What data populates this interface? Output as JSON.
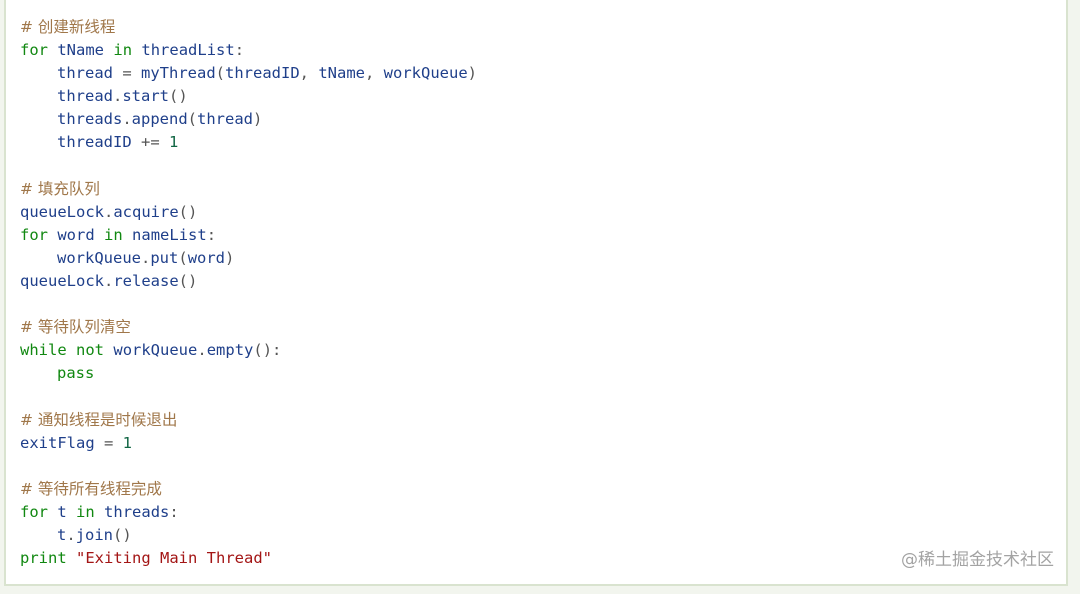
{
  "code_lines": [
    {
      "indent": false,
      "tokens": [
        {
          "t": "cm",
          "v": "# 创建新线程"
        }
      ]
    },
    {
      "indent": false,
      "tokens": [
        {
          "t": "kw",
          "v": "for"
        },
        {
          "t": "op",
          "v": " "
        },
        {
          "t": "id",
          "v": "tName"
        },
        {
          "t": "op",
          "v": " "
        },
        {
          "t": "kw",
          "v": "in"
        },
        {
          "t": "op",
          "v": " "
        },
        {
          "t": "id",
          "v": "threadList"
        },
        {
          "t": "op",
          "v": ":"
        }
      ]
    },
    {
      "indent": true,
      "tokens": [
        {
          "t": "id",
          "v": "thread"
        },
        {
          "t": "op",
          "v": " = "
        },
        {
          "t": "id",
          "v": "myThread"
        },
        {
          "t": "op",
          "v": "("
        },
        {
          "t": "id",
          "v": "threadID"
        },
        {
          "t": "op",
          "v": ", "
        },
        {
          "t": "id",
          "v": "tName"
        },
        {
          "t": "op",
          "v": ", "
        },
        {
          "t": "id",
          "v": "workQueue"
        },
        {
          "t": "op",
          "v": ")"
        }
      ]
    },
    {
      "indent": true,
      "tokens": [
        {
          "t": "id",
          "v": "thread"
        },
        {
          "t": "op",
          "v": "."
        },
        {
          "t": "id",
          "v": "start"
        },
        {
          "t": "op",
          "v": "()"
        }
      ]
    },
    {
      "indent": true,
      "tokens": [
        {
          "t": "id",
          "v": "threads"
        },
        {
          "t": "op",
          "v": "."
        },
        {
          "t": "id",
          "v": "append"
        },
        {
          "t": "op",
          "v": "("
        },
        {
          "t": "id",
          "v": "thread"
        },
        {
          "t": "op",
          "v": ")"
        }
      ]
    },
    {
      "indent": true,
      "tokens": [
        {
          "t": "id",
          "v": "threadID"
        },
        {
          "t": "op",
          "v": " += "
        },
        {
          "t": "num",
          "v": "1"
        }
      ]
    },
    {
      "indent": false,
      "tokens": []
    },
    {
      "indent": false,
      "tokens": [
        {
          "t": "cm",
          "v": "# 填充队列"
        }
      ]
    },
    {
      "indent": false,
      "tokens": [
        {
          "t": "id",
          "v": "queueLock"
        },
        {
          "t": "op",
          "v": "."
        },
        {
          "t": "id",
          "v": "acquire"
        },
        {
          "t": "op",
          "v": "()"
        }
      ]
    },
    {
      "indent": false,
      "tokens": [
        {
          "t": "kw",
          "v": "for"
        },
        {
          "t": "op",
          "v": " "
        },
        {
          "t": "id",
          "v": "word"
        },
        {
          "t": "op",
          "v": " "
        },
        {
          "t": "kw",
          "v": "in"
        },
        {
          "t": "op",
          "v": " "
        },
        {
          "t": "id",
          "v": "nameList"
        },
        {
          "t": "op",
          "v": ":"
        }
      ]
    },
    {
      "indent": true,
      "tokens": [
        {
          "t": "id",
          "v": "workQueue"
        },
        {
          "t": "op",
          "v": "."
        },
        {
          "t": "id",
          "v": "put"
        },
        {
          "t": "op",
          "v": "("
        },
        {
          "t": "id",
          "v": "word"
        },
        {
          "t": "op",
          "v": ")"
        }
      ]
    },
    {
      "indent": false,
      "tokens": [
        {
          "t": "id",
          "v": "queueLock"
        },
        {
          "t": "op",
          "v": "."
        },
        {
          "t": "id",
          "v": "release"
        },
        {
          "t": "op",
          "v": "()"
        }
      ]
    },
    {
      "indent": false,
      "tokens": []
    },
    {
      "indent": false,
      "tokens": [
        {
          "t": "cm",
          "v": "# 等待队列清空"
        }
      ]
    },
    {
      "indent": false,
      "tokens": [
        {
          "t": "kw",
          "v": "while"
        },
        {
          "t": "op",
          "v": " "
        },
        {
          "t": "kw",
          "v": "not"
        },
        {
          "t": "op",
          "v": " "
        },
        {
          "t": "id",
          "v": "workQueue"
        },
        {
          "t": "op",
          "v": "."
        },
        {
          "t": "id",
          "v": "empty"
        },
        {
          "t": "op",
          "v": "():"
        }
      ]
    },
    {
      "indent": true,
      "tokens": [
        {
          "t": "kw",
          "v": "pass"
        }
      ]
    },
    {
      "indent": false,
      "tokens": []
    },
    {
      "indent": false,
      "tokens": [
        {
          "t": "cm",
          "v": "# 通知线程是时候退出"
        }
      ]
    },
    {
      "indent": false,
      "tokens": [
        {
          "t": "id",
          "v": "exitFlag"
        },
        {
          "t": "op",
          "v": " = "
        },
        {
          "t": "num",
          "v": "1"
        }
      ]
    },
    {
      "indent": false,
      "tokens": []
    },
    {
      "indent": false,
      "tokens": [
        {
          "t": "cm",
          "v": "# 等待所有线程完成"
        }
      ]
    },
    {
      "indent": false,
      "tokens": [
        {
          "t": "kw",
          "v": "for"
        },
        {
          "t": "op",
          "v": " "
        },
        {
          "t": "id",
          "v": "t"
        },
        {
          "t": "op",
          "v": " "
        },
        {
          "t": "kw",
          "v": "in"
        },
        {
          "t": "op",
          "v": " "
        },
        {
          "t": "id",
          "v": "threads"
        },
        {
          "t": "op",
          "v": ":"
        }
      ]
    },
    {
      "indent": true,
      "tokens": [
        {
          "t": "id",
          "v": "t"
        },
        {
          "t": "op",
          "v": "."
        },
        {
          "t": "id",
          "v": "join"
        },
        {
          "t": "op",
          "v": "()"
        }
      ]
    },
    {
      "indent": false,
      "tokens": [
        {
          "t": "kw",
          "v": "print"
        },
        {
          "t": "op",
          "v": " "
        },
        {
          "t": "str",
          "v": "\"Exiting Main Thread\""
        }
      ]
    }
  ],
  "watermark": "@稀土掘金技术社区",
  "colors": {
    "comment": "#a0774a",
    "keyword": "#118811",
    "identifier": "#1f3f8a",
    "number": "#116644",
    "string": "#a31515",
    "border": "#d9e3cf"
  }
}
